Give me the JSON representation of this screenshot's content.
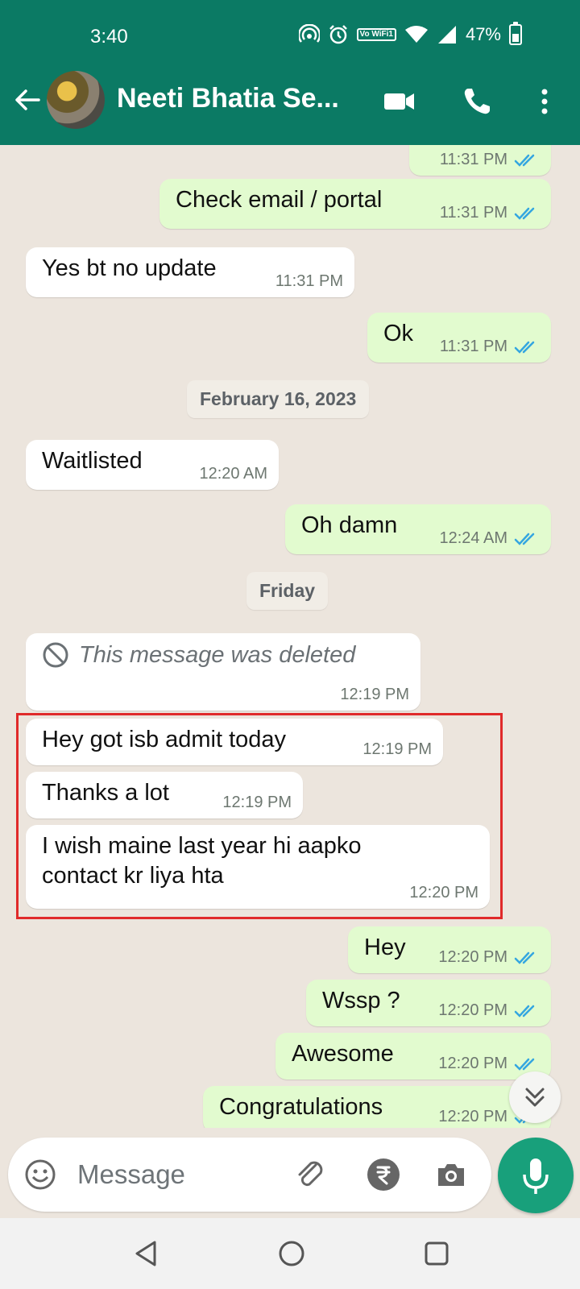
{
  "status_bar": {
    "time": "3:40",
    "volte_label": "Vo WiFi1",
    "battery_percent": "47%",
    "icons": [
      "hotspot-icon",
      "alarm-icon",
      "volte-wifi-icon",
      "wifi-icon",
      "signal-icon",
      "battery-icon"
    ]
  },
  "header": {
    "contact_name": "Neeti Bhatia Se...",
    "icons": [
      "back-arrow-icon",
      "avatar",
      "video-call-icon",
      "voice-call-icon",
      "more-options-icon"
    ]
  },
  "messages": [
    {
      "type": "out",
      "text": "",
      "time": "11:31 PM",
      "read": true
    },
    {
      "type": "out",
      "text": "Check email / portal",
      "time": "11:31 PM",
      "read": true
    },
    {
      "type": "in",
      "text": "Yes bt no update",
      "time": "11:31 PM"
    },
    {
      "type": "out",
      "text": "Ok",
      "time": "11:31 PM",
      "read": true
    },
    {
      "type": "date",
      "text": "February 16, 2023"
    },
    {
      "type": "in",
      "text": "Waitlisted",
      "time": "12:20 AM"
    },
    {
      "type": "out",
      "text": "Oh damn",
      "time": "12:24 AM",
      "read": true
    },
    {
      "type": "date",
      "text": "Friday"
    },
    {
      "type": "in",
      "text": "This message was deleted",
      "time": "12:19 PM",
      "deleted": true
    },
    {
      "type": "in",
      "text": "Hey got isb admit today",
      "time": "12:19 PM"
    },
    {
      "type": "in",
      "text": "Thanks a lot",
      "time": "12:19 PM"
    },
    {
      "type": "in",
      "text_line1": "I wish maine last year hi aapko",
      "text_line2": "contact kr liya hta",
      "time": "12:20 PM"
    },
    {
      "type": "out",
      "text": "Hey",
      "time": "12:20 PM",
      "read": true
    },
    {
      "type": "out",
      "text": "Wssp ?",
      "time": "12:20 PM",
      "read": true
    },
    {
      "type": "out",
      "text": "Awesome",
      "time": "12:20 PM",
      "read": true
    },
    {
      "type": "out",
      "text": "Congratulations",
      "time": "12:20 PM",
      "read": true
    }
  ],
  "composer": {
    "placeholder": "Message",
    "icons": [
      "emoji-icon",
      "attach-icon",
      "rupee-payment-icon",
      "camera-icon",
      "mic-icon"
    ]
  },
  "colors": {
    "header": "#0b7a64",
    "outgoing_bubble": "#e2fbcf",
    "incoming_bubble": "#ffffff",
    "chat_background": "#ece5dd",
    "read_ticks": "#34a6e0",
    "mic_button": "#18a07b",
    "highlight_box": "#e02a2a"
  }
}
